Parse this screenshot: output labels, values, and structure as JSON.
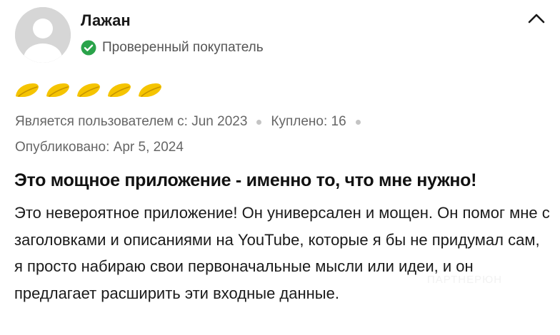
{
  "review": {
    "author": {
      "name": "Лажан",
      "avatar_icon": "default-avatar-icon",
      "verified_icon": "check-circle-icon",
      "verified_label": "Проверенный покупатель",
      "verified_color": "#2aa34a"
    },
    "collapse_icon": "chevron-up-icon",
    "rating": {
      "value": 5,
      "max": 5,
      "icon": "crescent-mark-icon",
      "color": "#f5c400"
    },
    "meta": {
      "member_since": "Является пользователем с: Jun 2023",
      "purchased": "Куплено: 16",
      "published": "Опубликовано: Apr 5, 2024"
    },
    "title": "Это мощное приложение - именно то, что мне нужно!",
    "body": "Это невероятное приложение! Он универсален и мощен. Он помог мне с заголовками и описаниями на YouTube, которые я бы не придумал сам, я просто набираю свои первоначальные мысли или идеи, и он предлагает расширить эти входные данные."
  }
}
